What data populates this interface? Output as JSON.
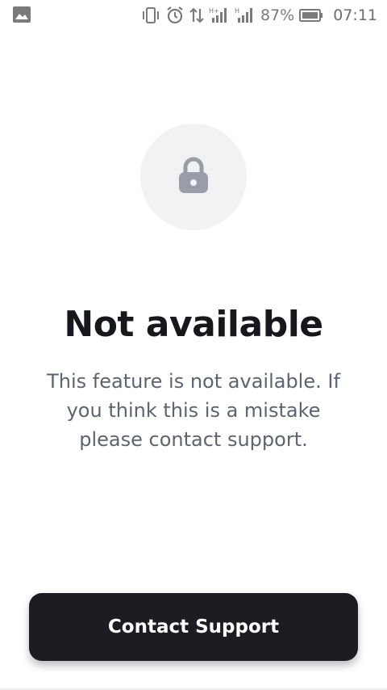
{
  "status_bar": {
    "battery_percent": "87%",
    "time": "07:11",
    "icons": [
      "image-icon",
      "vibrate-icon",
      "alarm-icon",
      "data-transfer-icon",
      "signal-h-plus-icon",
      "signal-h-icon",
      "battery-icon"
    ]
  },
  "main": {
    "icon": "lock-icon",
    "title": "Not available",
    "message": "This feature is not available. If you think this is a mistake please contact support."
  },
  "actions": {
    "contact_label": "Contact Support"
  },
  "colors": {
    "button_bg": "#1b1d22",
    "title": "#16181c",
    "message": "#5d6470",
    "lock_circle": "#f1f2f4",
    "lock_icon": "#9a9da7"
  }
}
